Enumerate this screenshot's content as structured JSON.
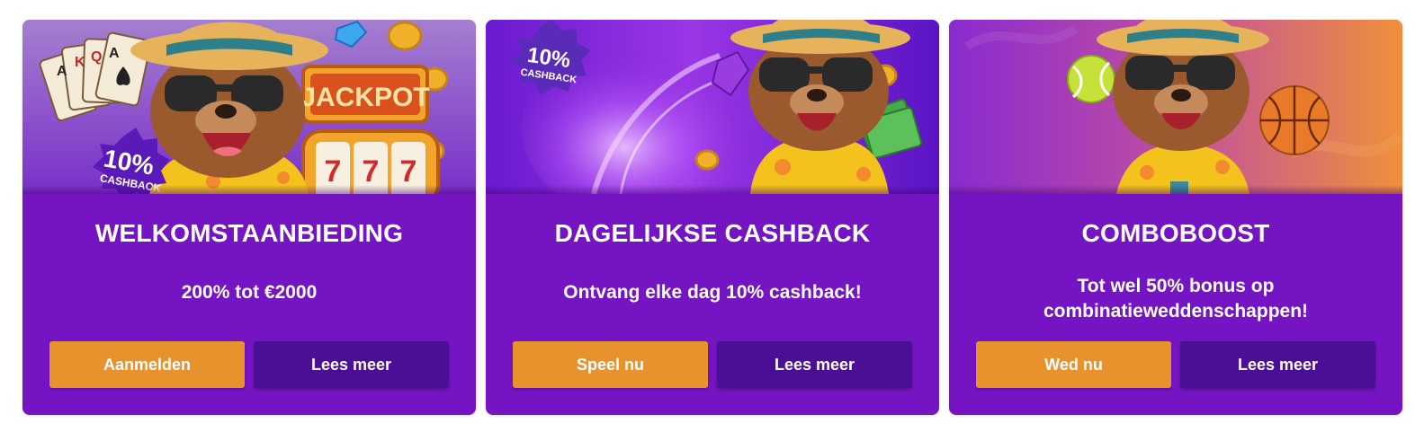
{
  "cards": [
    {
      "title": "WELKOMSTAANBIEDING",
      "description": "200% tot €2000",
      "primary_button": "Aanmelden",
      "secondary_button": "Lees meer",
      "badge": {
        "value": "10%",
        "label": "CASHBACK"
      },
      "sign": "JACKPOT",
      "reels": [
        "7",
        "7",
        "7"
      ],
      "cards_ranks": [
        "A",
        "K",
        "Q",
        "A"
      ]
    },
    {
      "title": "DAGELIJKSE CASHBACK",
      "description": "Ontvang elke dag 10% cashback!",
      "primary_button": "Speel nu",
      "secondary_button": "Lees meer",
      "badge": {
        "value": "10%",
        "label": "CASHBACK"
      }
    },
    {
      "title": "COMBOBOOST",
      "description": "Tot wel 50% bonus op combinatieweddenschappen!",
      "primary_button": "Wed nu",
      "secondary_button": "Lees meer"
    }
  ],
  "colors": {
    "card_bg": "#7414c2",
    "primary_button": "#e8922e",
    "secondary_button": "#4a0f94"
  },
  "icons": [
    "bear-mascot-icon",
    "playing-cards-icon",
    "slot-machine-icon",
    "coin-icon",
    "gem-icon",
    "cash-icon",
    "tennis-ball-icon",
    "basketball-icon"
  ]
}
